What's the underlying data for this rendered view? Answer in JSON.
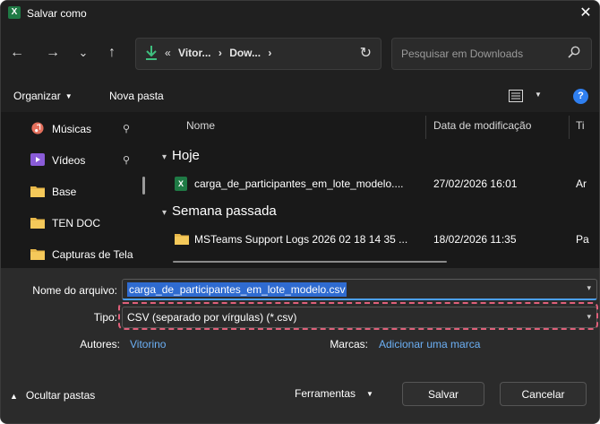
{
  "window": {
    "title": "Salvar como",
    "app_icon": "excel-icon",
    "close_glyph": "✕"
  },
  "nav": {
    "back_glyph": "←",
    "forward_glyph": "→",
    "recent_glyph": "⌄",
    "up_glyph": "↑",
    "breadcrumb": [
      "«",
      "Vitor...",
      "›",
      "Dow...",
      "›"
    ],
    "refresh_glyph": "↻",
    "search_placeholder": "Pesquisar em Downloads"
  },
  "toolbar": {
    "organize_label": "Organizar",
    "new_folder_label": "Nova pasta",
    "help_glyph": "?"
  },
  "sidebar": {
    "items": [
      {
        "label": "Músicas",
        "icon": "music-icon",
        "pinned": true
      },
      {
        "label": "Vídeos",
        "icon": "video-icon",
        "pinned": true
      },
      {
        "label": "Base",
        "icon": "folder-icon",
        "pinned": false
      },
      {
        "label": "TEN DOC",
        "icon": "folder-icon",
        "pinned": false
      },
      {
        "label": "Capturas de Tela",
        "icon": "folder-icon",
        "pinned": false
      }
    ],
    "pin_glyph": "📌"
  },
  "filelist": {
    "columns": [
      "Nome",
      "Data de modificação",
      "Ti"
    ],
    "groups": [
      {
        "label": "Hoje",
        "files": [
          {
            "name": "carga_de_participantes_em_lote_modelo....",
            "date": "27/02/2026 16:01",
            "type": "Ar",
            "icon": "excel-csv-icon"
          }
        ]
      },
      {
        "label": "Semana passada",
        "files": [
          {
            "name": "MSTeams Support Logs 2026 02 18 14 35 ...",
            "date": "18/02/2026 11:35",
            "type": "Pa",
            "icon": "folder-icon"
          }
        ]
      }
    ]
  },
  "form": {
    "filename_label": "Nome do arquivo:",
    "filename_value": "carga_de_participantes_em_lote_modelo.csv",
    "type_label": "Tipo:",
    "type_value": "CSV (separado por vírgulas) (*.csv)",
    "authors_label": "Autores:",
    "authors_value": "Vitorino",
    "tags_label": "Marcas:",
    "tags_value": "Adicionar uma marca"
  },
  "footer": {
    "hide_folders_label": "Ocultar pastas",
    "tools_label": "Ferramentas",
    "save_label": "Salvar",
    "cancel_label": "Cancelar"
  },
  "colors": {
    "accent": "#4ca0f0",
    "selection": "#2f6bd0",
    "highlight_dashes": "#e0607a",
    "link": "#6cb0f5"
  }
}
